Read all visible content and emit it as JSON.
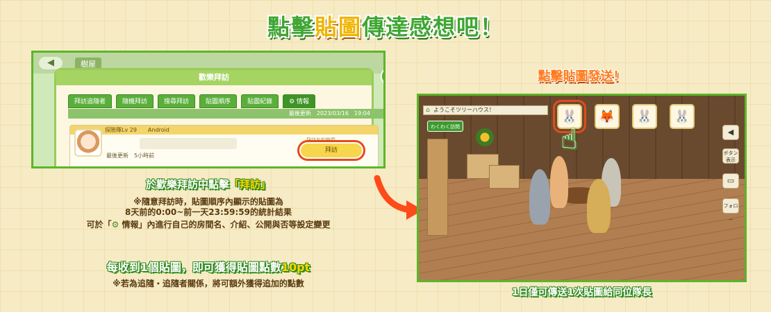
{
  "banner": {
    "part1": "點擊",
    "highlight": "貼圖",
    "part2": "傳達感想吧！"
  },
  "left_panel": {
    "back_arrow": "◀",
    "location_title": "樹屋",
    "window_title": "歡樂拜訪",
    "close_icon": "✕",
    "tabs": [
      "拜訪追隨者",
      "隨機拜訪",
      "搜尋拜訪",
      "貼圖順序",
      "貼圖紀錄",
      "⚙ 情報"
    ],
    "date_label": "最後更新　2023/03/16　19:04",
    "card": {
      "header": "探險隊Lv 29　　Android",
      "updated_label": "最後更新",
      "updated_value": "5小時前",
      "visit_hint": "拜訪友的樹屋",
      "visit_button": "拜訪"
    }
  },
  "left_desc": {
    "headline_part1": "於歡樂拜訪中點擊",
    "headline_highlight": "「拜訪」",
    "note_line1": "※隨意拜訪時，貼圖順序內顯示的貼圖為",
    "note_line2": "8天前的0:00~前一天23:59:59的統計結果",
    "note_line3_pre": "可於「",
    "note_line3_gear": "⚙",
    "note_line3_post": " 情報」內進行自己的房間名、介紹、公開與否等設定變更"
  },
  "reward": {
    "headline_part1": "每收到1個貼圖，即可獲得貼圖點數",
    "headline_highlight": "10pt",
    "note": "※若為追隨・追隨者關係，將可額外獲得追加的點數"
  },
  "right_panel": {
    "label": "點擊貼圖發送！",
    "header": "ようこそツリーハウス！",
    "go_button": "わくわく訪問",
    "stickers": [
      "🐰",
      "🦊",
      "🐰",
      "🐰"
    ],
    "side_buttons": [
      "◀",
      "ボタン表示",
      "▭",
      "フォロー"
    ],
    "bottom_note": "1日僅可傳送1次貼圖給同位隊長"
  },
  "colors": {
    "accent_green": "#3fa632",
    "accent_orange": "#ff7a1a",
    "highlight_yellow": "#f0b400",
    "highlight_ring": "#e34b1e"
  }
}
